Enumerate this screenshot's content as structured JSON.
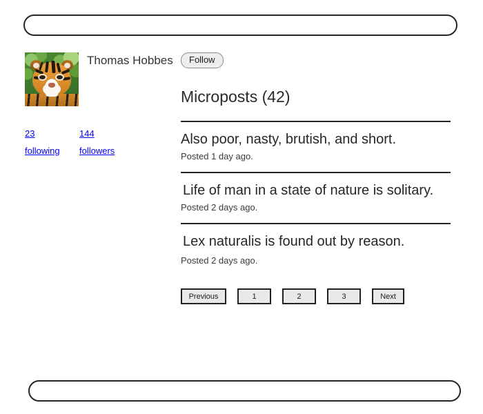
{
  "header": {
    "bar_label": ""
  },
  "footer": {
    "bar_label": ""
  },
  "profile": {
    "display_name": "Thomas Hobbes",
    "avatar_alt": "tiger-gravatar",
    "follow_button_label": "Follow",
    "stats": [
      {
        "id": "following",
        "count": "23",
        "label": "following"
      },
      {
        "id": "followers",
        "count": "144",
        "label": "followers"
      }
    ]
  },
  "microposts": {
    "heading": "Microposts (42)",
    "count": 42,
    "items": [
      {
        "content": "Also poor, nasty, brutish, and short.",
        "timestamp": "Posted 1 day ago."
      },
      {
        "content": "Life of man in a state of nature is solitary.",
        "timestamp": "Posted 2 days ago."
      },
      {
        "content": "Lex naturalis is found out by reason.",
        "timestamp": "Posted 2 days ago."
      }
    ]
  },
  "pagination": {
    "previous_label": "Previous",
    "next_label": "Next",
    "pages": [
      "1",
      "2",
      "3"
    ]
  },
  "colors": {
    "link": "#0000EE",
    "text": "#2B2B2B",
    "rule": "#232323",
    "button_face": "#E9E9E9",
    "button_border": "#222222"
  }
}
